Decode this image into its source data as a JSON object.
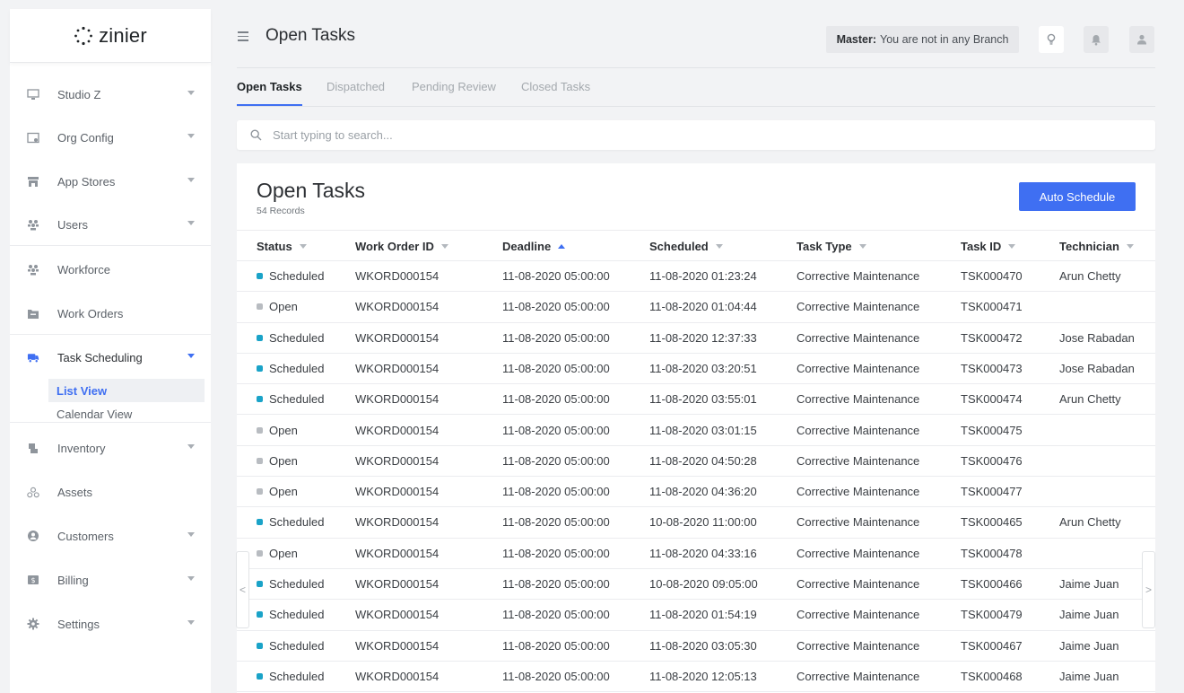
{
  "app": {
    "name": "zinier"
  },
  "sidebar": {
    "items": [
      {
        "label": "Studio Z",
        "icon": "monitor-icon",
        "expandable": true
      },
      {
        "label": "Org Config",
        "icon": "org-config-icon",
        "expandable": true
      },
      {
        "label": "App Stores",
        "icon": "store-icon",
        "expandable": true
      },
      {
        "label": "Users",
        "icon": "users-icon",
        "expandable": true
      },
      {
        "label": "Workforce",
        "icon": "workforce-icon",
        "expandable": false
      },
      {
        "label": "Work Orders",
        "icon": "folder-icon",
        "expandable": false
      },
      {
        "label": "Task Scheduling",
        "icon": "truck-icon",
        "expandable": true,
        "active": true
      },
      {
        "label": "Inventory",
        "icon": "inventory-icon",
        "expandable": true
      },
      {
        "label": "Assets",
        "icon": "assets-icon",
        "expandable": false
      },
      {
        "label": "Customers",
        "icon": "customer-icon",
        "expandable": true
      },
      {
        "label": "Billing",
        "icon": "billing-icon",
        "expandable": true
      },
      {
        "label": "Settings",
        "icon": "gear-icon",
        "expandable": true
      }
    ],
    "subitems": [
      {
        "label": "List View",
        "selected": true
      },
      {
        "label": "Calendar View",
        "selected": false
      }
    ]
  },
  "header": {
    "title": "Open Tasks",
    "branch_label": "Master:",
    "branch_text": "You are not in any Branch"
  },
  "tabs": [
    {
      "label": "Open Tasks",
      "active": true
    },
    {
      "label": "Dispatched",
      "active": false
    },
    {
      "label": "Pending Review",
      "active": false
    },
    {
      "label": "Closed Tasks",
      "active": false
    }
  ],
  "search": {
    "placeholder": "Start typing to search...",
    "value": ""
  },
  "panel": {
    "title": "Open Tasks",
    "record_count": "54 Records",
    "auto_schedule_label": "Auto Schedule"
  },
  "table": {
    "columns": [
      "Status",
      "Work Order ID",
      "Deadline",
      "Scheduled",
      "Task Type",
      "Task ID",
      "Technician"
    ],
    "sorted_column": "Deadline",
    "rows": [
      [
        "Scheduled",
        "WKORD000154",
        "11-08-2020 05:00:00",
        "11-08-2020 01:23:24",
        "Corrective Maintenance",
        "TSK000470",
        "Arun Chetty"
      ],
      [
        "Open",
        "WKORD000154",
        "11-08-2020 05:00:00",
        "11-08-2020 01:04:44",
        "Corrective Maintenance",
        "TSK000471",
        ""
      ],
      [
        "Scheduled",
        "WKORD000154",
        "11-08-2020 05:00:00",
        "11-08-2020 12:37:33",
        "Corrective Maintenance",
        "TSK000472",
        "Jose Rabadan"
      ],
      [
        "Scheduled",
        "WKORD000154",
        "11-08-2020 05:00:00",
        "11-08-2020 03:20:51",
        "Corrective Maintenance",
        "TSK000473",
        "Jose Rabadan"
      ],
      [
        "Scheduled",
        "WKORD000154",
        "11-08-2020 05:00:00",
        "11-08-2020 03:55:01",
        "Corrective Maintenance",
        "TSK000474",
        "Arun Chetty"
      ],
      [
        "Open",
        "WKORD000154",
        "11-08-2020 05:00:00",
        "11-08-2020 03:01:15",
        "Corrective Maintenance",
        "TSK000475",
        ""
      ],
      [
        "Open",
        "WKORD000154",
        "11-08-2020 05:00:00",
        "11-08-2020 04:50:28",
        "Corrective Maintenance",
        "TSK000476",
        ""
      ],
      [
        "Open",
        "WKORD000154",
        "11-08-2020 05:00:00",
        "11-08-2020 04:36:20",
        "Corrective Maintenance",
        "TSK000477",
        ""
      ],
      [
        "Scheduled",
        "WKORD000154",
        "11-08-2020 05:00:00",
        "10-08-2020 11:00:00",
        "Corrective Maintenance",
        "TSK000465",
        "Arun Chetty"
      ],
      [
        "Open",
        "WKORD000154",
        "11-08-2020 05:00:00",
        "11-08-2020 04:33:16",
        "Corrective Maintenance",
        "TSK000478",
        ""
      ],
      [
        "Scheduled",
        "WKORD000154",
        "11-08-2020 05:00:00",
        "10-08-2020 09:05:00",
        "Corrective Maintenance",
        "TSK000466",
        "Jaime Juan"
      ],
      [
        "Scheduled",
        "WKORD000154",
        "11-08-2020 05:00:00",
        "11-08-2020 01:54:19",
        "Corrective Maintenance",
        "TSK000479",
        "Jaime Juan"
      ],
      [
        "Scheduled",
        "WKORD000154",
        "11-08-2020 05:00:00",
        "11-08-2020 03:05:30",
        "Corrective Maintenance",
        "TSK000467",
        "Jaime Juan"
      ],
      [
        "Scheduled",
        "WKORD000154",
        "11-08-2020 05:00:00",
        "11-08-2020 12:05:13",
        "Corrective Maintenance",
        "TSK000468",
        "Jaime Juan"
      ]
    ]
  },
  "colors": {
    "accent": "#3f6ff2",
    "status_scheduled": "#1aa3c8",
    "status_open": "#b8bcc1"
  },
  "pager": {
    "prev": "<",
    "next": ">"
  }
}
